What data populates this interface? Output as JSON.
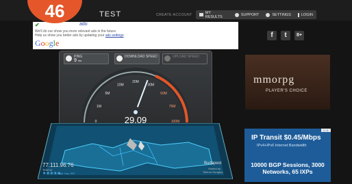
{
  "header": {
    "brand": "TEST",
    "create_account": "CREATE ACCOUNT",
    "nav": [
      {
        "label": "MY RESULTS",
        "icon": "folder-icon"
      },
      {
        "label": "SUPPORT",
        "icon": "help-icon"
      },
      {
        "label": "SETTINGS",
        "icon": "gear-icon"
      },
      {
        "label": "LOGIN",
        "icon": "login-icon"
      }
    ]
  },
  "badge": {
    "text": "46"
  },
  "ad_notice": {
    "title_fragment": "ado",
    "line1": "We'll do our         show you more relevant ads in the future.",
    "line2_prefix": "Help us show you better ads by updating your ",
    "link": "ads settings",
    "line2_suffix": ".",
    "google": [
      "G",
      "o",
      "o",
      "g",
      "l",
      "e"
    ]
  },
  "social": {
    "facebook": "f",
    "twitter": "t",
    "googleplus": "8+"
  },
  "speedtest": {
    "ping_label": "PING",
    "ping_value": "9",
    "ping_unit": "ms",
    "download_label": "DOWNLOAD SPEED",
    "upload_label": "UPLOAD SPEED",
    "current_speed": "29.09",
    "speed_unit": "Mbps",
    "gauge_ticks": [
      "0",
      "1M",
      "5M",
      "10M",
      "20M",
      "30M",
      "50M",
      "75M",
      "100M"
    ],
    "gauge_value_mbps": 29.09
  },
  "map": {
    "ip_address": "77.111.96.76",
    "isp_label": "Telenor",
    "rate_isp": "Rate Your ISP",
    "stars": "★★★★★",
    "server_city": "Budapest",
    "server_hosted": "Hosted by",
    "server_host": "Telenor Hungary"
  },
  "ads": {
    "mmorpg_logo": "mmorpg",
    "mmorpg_tag": "PLAYER'S CHOICE",
    "ip_title": "IP Transit $0.45/Mbps",
    "ip_sub": "IPv4+IPv6 Internet Bandwidth",
    "ip_sessions": "10000 BGP Sessions, 3000 Networks, 65 IXPs",
    "ad_choice": "▷ X"
  }
}
